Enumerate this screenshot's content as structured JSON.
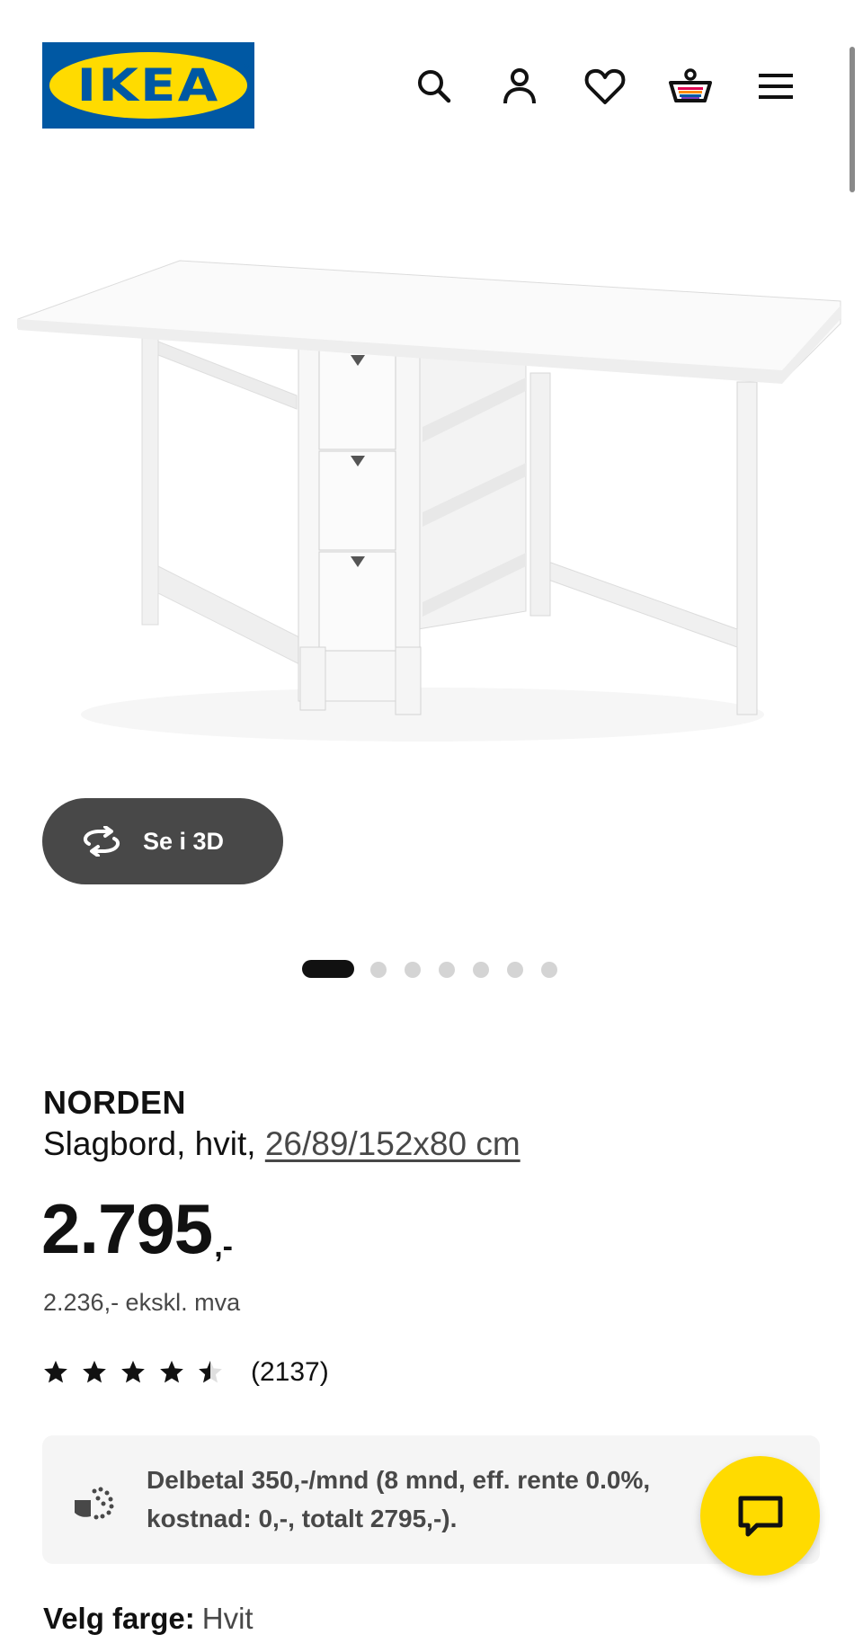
{
  "brand": {
    "logo_text": "IKEA",
    "colors": {
      "blue": "#0058a3",
      "yellow": "#ffdb00"
    }
  },
  "header": {
    "icons": [
      "search-icon",
      "account-icon",
      "heart-icon",
      "cart-icon",
      "menu-icon"
    ]
  },
  "gallery": {
    "view_3d_label": "Se i 3D",
    "slide_count": 7,
    "active_slide": 1
  },
  "product": {
    "name": "NORDEN",
    "description": "Slagbord, hvit,",
    "measurements": "26/89/152x80 cm",
    "price_main": "2.795",
    "price_suffix": ",-",
    "price_ex_vat": "2.236,- ekskl. mva",
    "rating": 4.5,
    "rating_count": "(2137)"
  },
  "installment": {
    "text": "Delbetal 350,-/mnd (8 mnd, eff. rente 0.0%, kostnad: 0,-, totalt 2795,-)."
  },
  "color_select": {
    "label": "Velg farge:",
    "value": "Hvit"
  }
}
